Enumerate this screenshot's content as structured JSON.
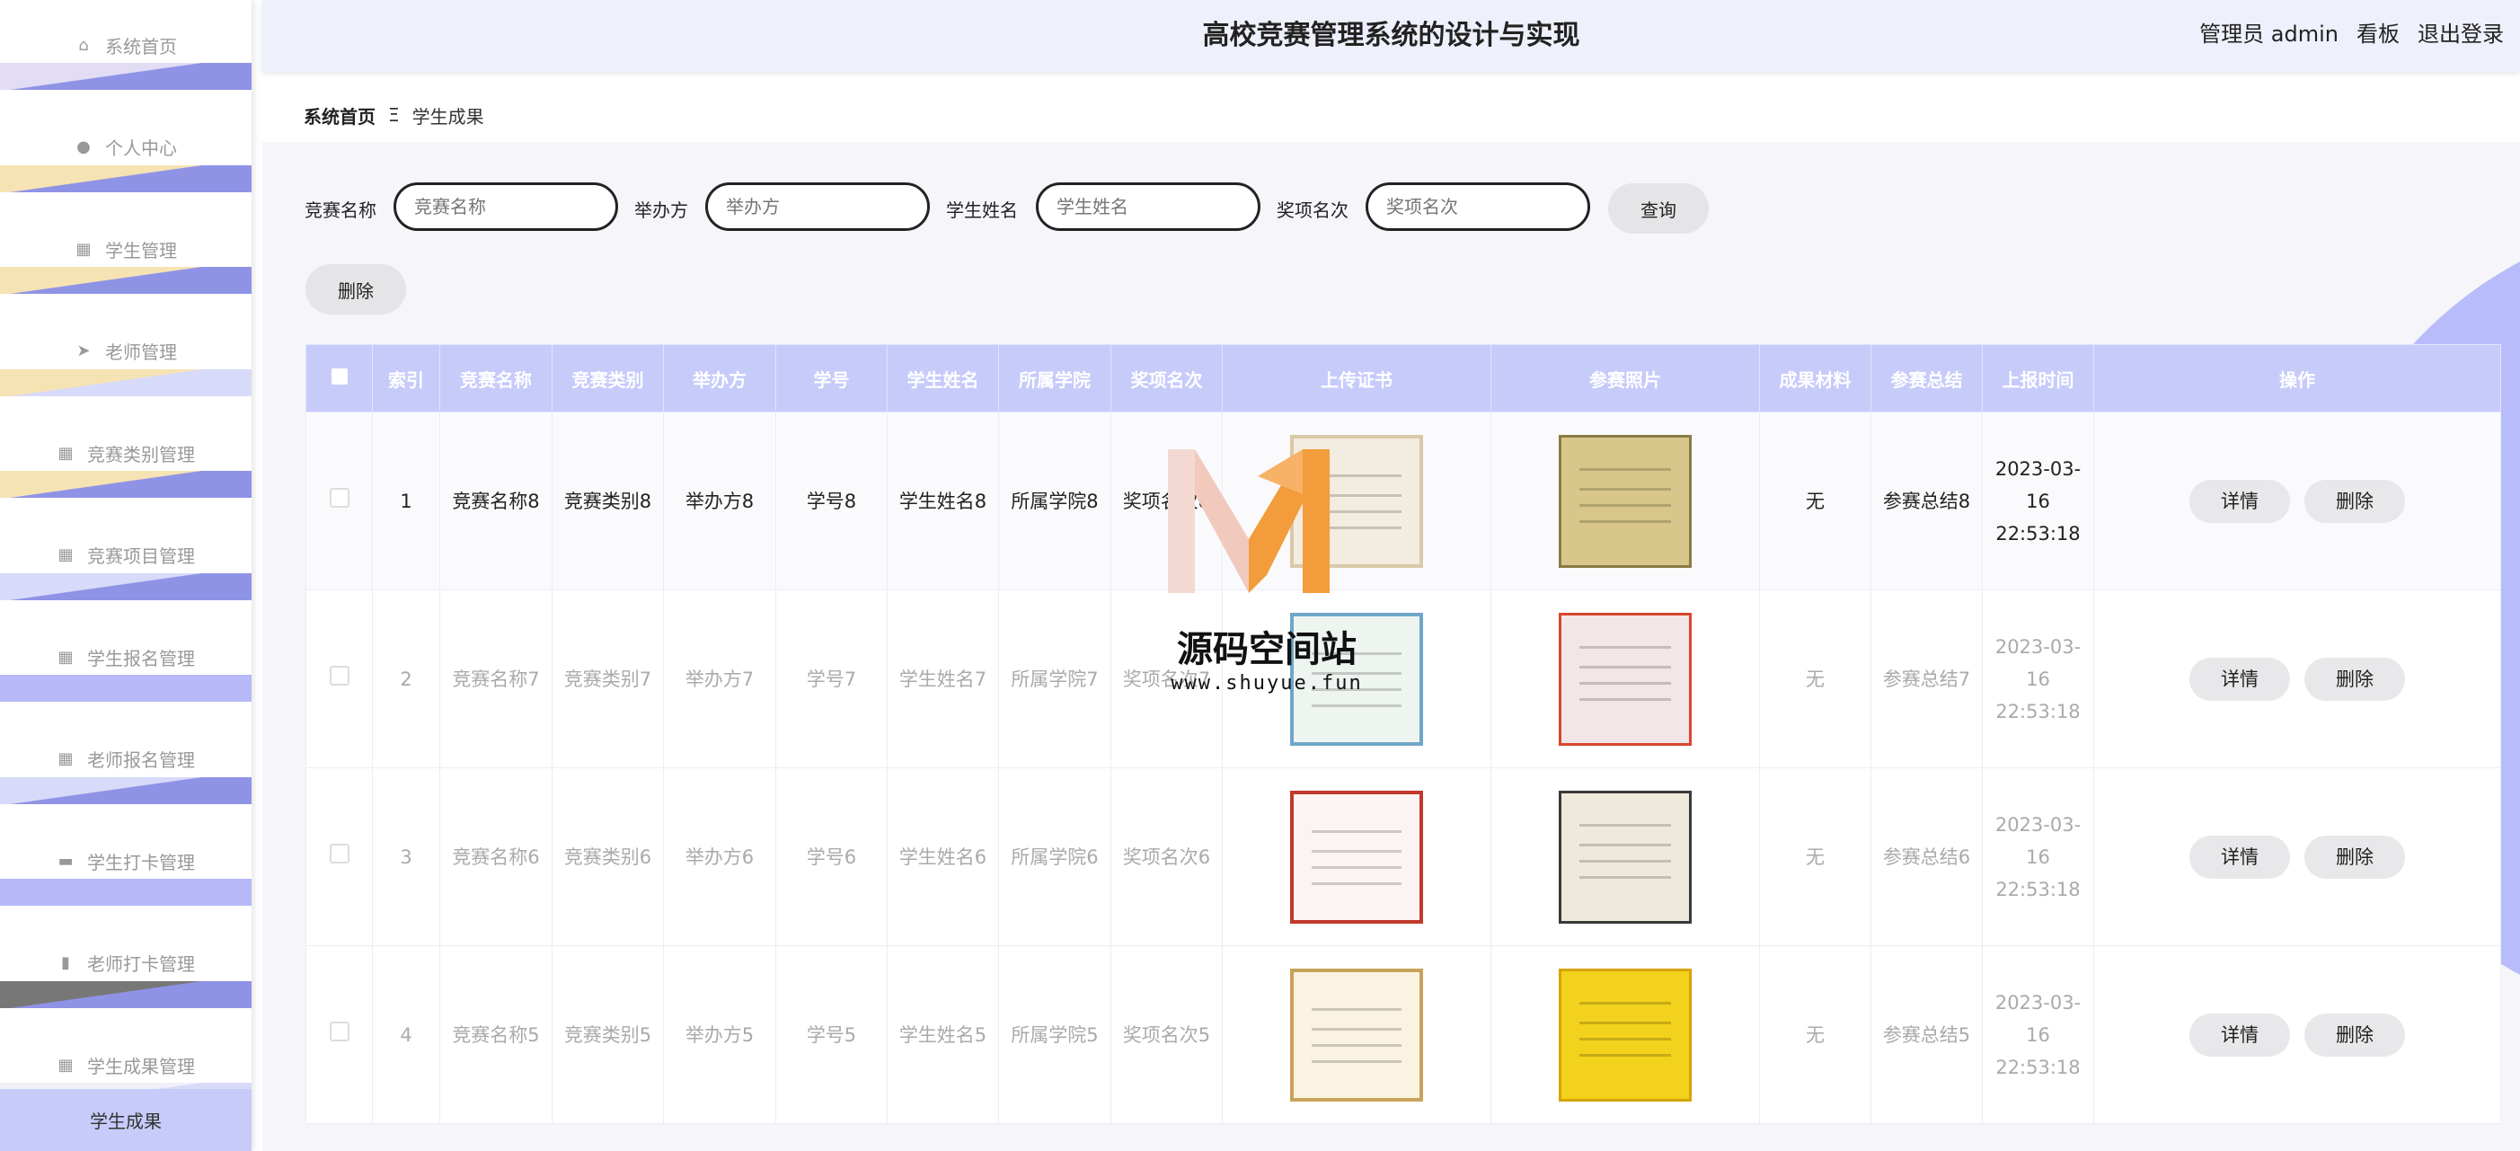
{
  "app": {
    "title": "高校竞赛管理系统的设计与实现",
    "user_label": "管理员 admin",
    "board_link": "看板",
    "logout_link": "退出登录"
  },
  "sidebar": {
    "items": [
      {
        "label": "系统首页",
        "icon": "home-icon"
      },
      {
        "label": "个人中心",
        "icon": "user-icon"
      },
      {
        "label": "学生管理",
        "icon": "grid-icon"
      },
      {
        "label": "老师管理",
        "icon": "send-icon"
      },
      {
        "label": "竞赛类别管理",
        "icon": "grid-icon"
      },
      {
        "label": "竞赛项目管理",
        "icon": "grid-icon"
      },
      {
        "label": "学生报名管理",
        "icon": "grid-icon"
      },
      {
        "label": "老师报名管理",
        "icon": "apps-icon"
      },
      {
        "label": "学生打卡管理",
        "icon": "message-icon"
      },
      {
        "label": "老师打卡管理",
        "icon": "bar-chart-icon"
      },
      {
        "label": "学生成果管理",
        "icon": "grid-icon"
      }
    ],
    "active_sub_item": "学生成果"
  },
  "breadcrumb": {
    "home": "系统首页",
    "separator": "Ξ",
    "current": "学生成果"
  },
  "search": {
    "fields": [
      {
        "label": "竞赛名称",
        "placeholder": "竞赛名称"
      },
      {
        "label": "举办方",
        "placeholder": "举办方"
      },
      {
        "label": "学生姓名",
        "placeholder": "学生姓名"
      },
      {
        "label": "奖项名次",
        "placeholder": "奖项名次"
      }
    ],
    "query_button": "查询",
    "delete_button": "删除"
  },
  "table": {
    "columns": [
      "索引",
      "竞赛名称",
      "竞赛类别",
      "举办方",
      "学号",
      "学生姓名",
      "所属学院",
      "奖项名次",
      "上传证书",
      "参赛照片",
      "成果材料",
      "参赛总结",
      "上报时间",
      "操作"
    ],
    "rows": [
      {
        "index": "1",
        "name": "竞赛名称8",
        "category": "竞赛类别8",
        "organizer": "举办方8",
        "student_no": "学号8",
        "student_name": "学生姓名8",
        "college": "所属学院8",
        "award": "奖项名次8",
        "material": "无",
        "summary": "参赛总结8",
        "time": "2023-03-16 22:53:18"
      },
      {
        "index": "2",
        "name": "竞赛名称7",
        "category": "竞赛类别7",
        "organizer": "举办方7",
        "student_no": "学号7",
        "student_name": "学生姓名7",
        "college": "所属学院7",
        "award": "奖项名次7",
        "material": "无",
        "summary": "参赛总结7",
        "time": "2023-03-16 22:53:18"
      },
      {
        "index": "3",
        "name": "竞赛名称6",
        "category": "竞赛类别6",
        "organizer": "举办方6",
        "student_no": "学号6",
        "student_name": "学生姓名6",
        "college": "所属学院6",
        "award": "奖项名次6",
        "material": "无",
        "summary": "参赛总结6",
        "time": "2023-03-16 22:53:18"
      },
      {
        "index": "4",
        "name": "竞赛名称5",
        "category": "竞赛类别5",
        "organizer": "举办方5",
        "student_no": "学号5",
        "student_name": "学生姓名5",
        "college": "所属学院5",
        "award": "奖项名次5",
        "material": "无",
        "summary": "参赛总结5",
        "time": "2023-03-16 22:53:18"
      }
    ],
    "detail_button": "详情",
    "delete_button": "删除"
  },
  "watermark": {
    "text": "源码空间站",
    "url": "www.shuyue.fun"
  },
  "colors": {
    "accent": "#c7cbfa",
    "decor_circle": "#b9bcfb",
    "band_blue": "#8f93e6",
    "band_yellow": "#f6e3b4"
  }
}
